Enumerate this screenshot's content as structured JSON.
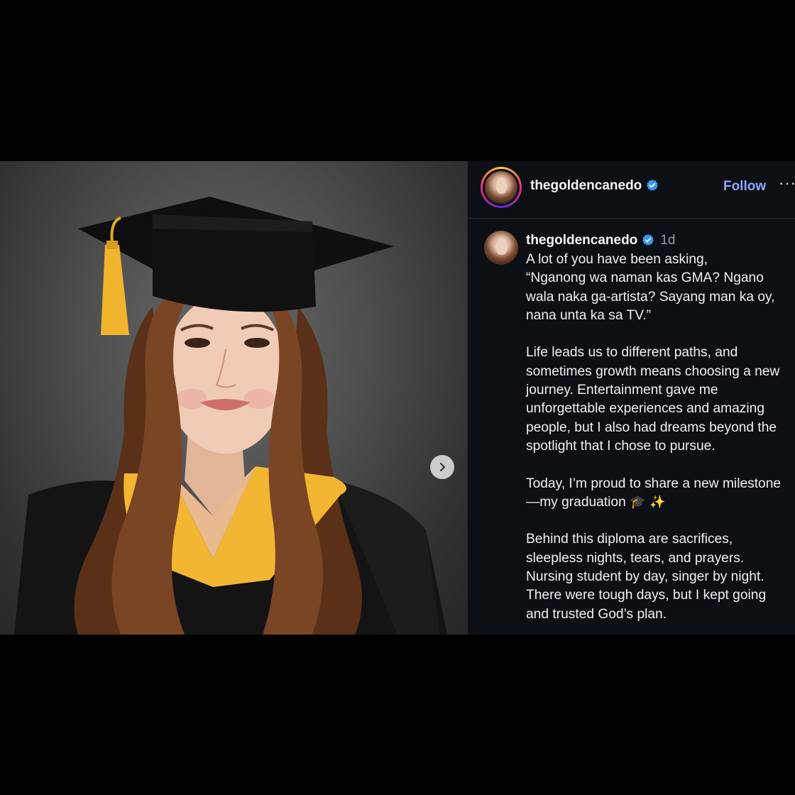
{
  "post": {
    "username": "thegoldencanedo",
    "follow_label": "Follow",
    "more_label": "···",
    "time": "1d",
    "caption_paragraphs": [
      "A lot of you have been asking,\n“Nganong wa naman kas GMA? Ngano wala naka ga-artista? Sayang man ka oy, nana unta ka sa TV.”",
      "Life leads us to different paths, and sometimes growth means choosing a new journey. Entertainment gave me unforgettable experiences and amazing people, but I also had dreams beyond the spotlight that I chose to pursue.",
      "Today, I’m proud to share a new milestone—my graduation",
      "Behind this diploma are sacrifices, sleepless nights, tears, and prayers. Nursing student by day, singer by night. There were tough days, but I kept going and trusted God’s plan."
    ],
    "graduation_emojis": "🎓 ✨"
  },
  "icons": {
    "verified": "verified-badge-icon",
    "next": "chevron-right-icon",
    "more": "more-options-icon"
  },
  "colors": {
    "panel_bg": "#0c0f14",
    "follow": "#8fa8ff",
    "verified": "#3797f0",
    "timestamp": "#9a9ea6"
  }
}
